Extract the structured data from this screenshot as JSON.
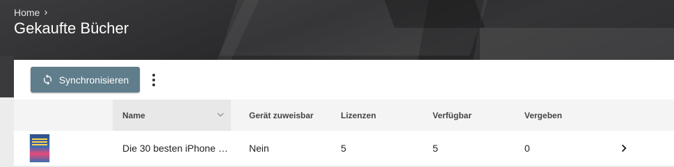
{
  "breadcrumb": {
    "home": "Home"
  },
  "page": {
    "title": "Gekaufte Bücher"
  },
  "toolbar": {
    "sync_label": "Synchronisieren"
  },
  "table": {
    "headers": {
      "name": "Name",
      "assignable": "Gerät zuweisbar",
      "licenses": "Lizenzen",
      "available": "Verfügbar",
      "assigned": "Vergeben"
    },
    "rows": [
      {
        "name": "Die 30 besten iPhone …",
        "assignable": "Nein",
        "licenses": "5",
        "available": "5",
        "assigned": "0"
      }
    ]
  },
  "colors": {
    "button": "#607d8b",
    "header_bg": "#2f2f31"
  }
}
